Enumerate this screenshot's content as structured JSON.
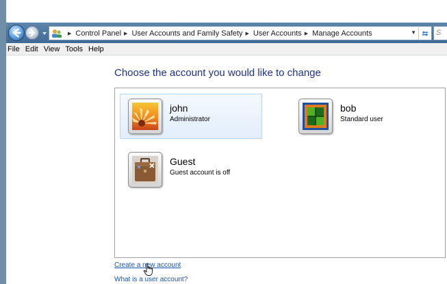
{
  "address_bar": {
    "crumbs": [
      "Control Panel",
      "User Accounts and Family Safety",
      "User Accounts",
      "Manage Accounts"
    ],
    "search_placeholder": "S"
  },
  "menu": {
    "items": [
      "File",
      "Edit",
      "View",
      "Tools",
      "Help"
    ]
  },
  "main": {
    "title": "Choose the account you would like to change",
    "accounts": [
      {
        "name": "john",
        "type": "Administrator",
        "icon": "flower-icon",
        "selected": true
      },
      {
        "name": "bob",
        "type": "Standard user",
        "icon": "chess-board-icon",
        "selected": false
      },
      {
        "name": "Guest",
        "type": "Guest account is off",
        "icon": "briefcase-icon",
        "selected": false
      }
    ],
    "links": {
      "create": "Create a new account",
      "what": "What is a user account?"
    }
  },
  "colors": {
    "title": "#1e3287",
    "link": "#1a55b0",
    "nav_bar": "#4f79a2",
    "selected_tile": "#e2eefb"
  }
}
